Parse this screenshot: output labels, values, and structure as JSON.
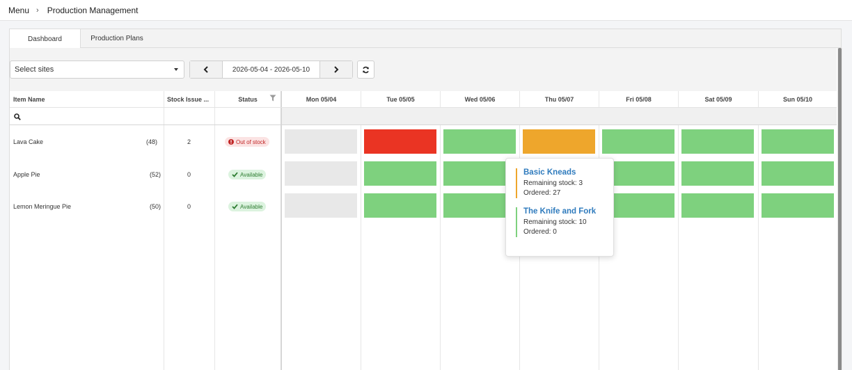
{
  "breadcrumb": {
    "menu": "Menu",
    "current": "Production Management"
  },
  "tabs": [
    "Dashboard",
    "Production Plans"
  ],
  "toolbar": {
    "sites_placeholder": "Select sites",
    "date_range": "2026-05-04 - 2026-05-10"
  },
  "columns": {
    "item_name": "Item Name",
    "stock_issue": "Stock Issue ...",
    "status": "Status"
  },
  "days": [
    "Mon 05/04",
    "Tue 05/05",
    "Wed 05/06",
    "Thu 05/07",
    "Fri 05/08",
    "Sat 05/09",
    "Sun 05/10"
  ],
  "rows": [
    {
      "name": "Lava Cake",
      "qty": "(48)",
      "stock_issue": "2",
      "status": "Out of stock",
      "status_type": "out"
    },
    {
      "name": "Apple Pie",
      "qty": "(52)",
      "stock_issue": "0",
      "status": "Available",
      "status_type": "ok"
    },
    {
      "name": "Lemon Meringue Pie",
      "qty": "(50)",
      "stock_issue": "0",
      "status": "Available",
      "status_type": "ok"
    }
  ],
  "day_states": [
    [
      "empty",
      "red",
      "green",
      "orange",
      "green",
      "green",
      "green"
    ],
    [
      "empty",
      "green",
      "green",
      "green",
      "green",
      "green",
      "green"
    ],
    [
      "empty",
      "green",
      "green",
      "green",
      "green",
      "green",
      "green"
    ]
  ],
  "state_colors": {
    "empty": "#e8e8e8",
    "red": "#ea3423",
    "green": "#7ed17e",
    "orange": "#eea62c"
  },
  "tooltip": {
    "entries": [
      {
        "name": "Basic Kneads",
        "remaining": "Remaining stock: 3",
        "ordered": "Ordered: 27",
        "color": "#eea62c"
      },
      {
        "name": "The Knife and Fork",
        "remaining": "Remaining stock: 10",
        "ordered": "Ordered: 0",
        "color": "#7ed17e"
      }
    ]
  },
  "icons": {
    "prev": "chevron-left-icon",
    "next": "chevron-right-icon",
    "refresh": "refresh-icon",
    "filter": "funnel-icon",
    "search": "search-icon"
  }
}
